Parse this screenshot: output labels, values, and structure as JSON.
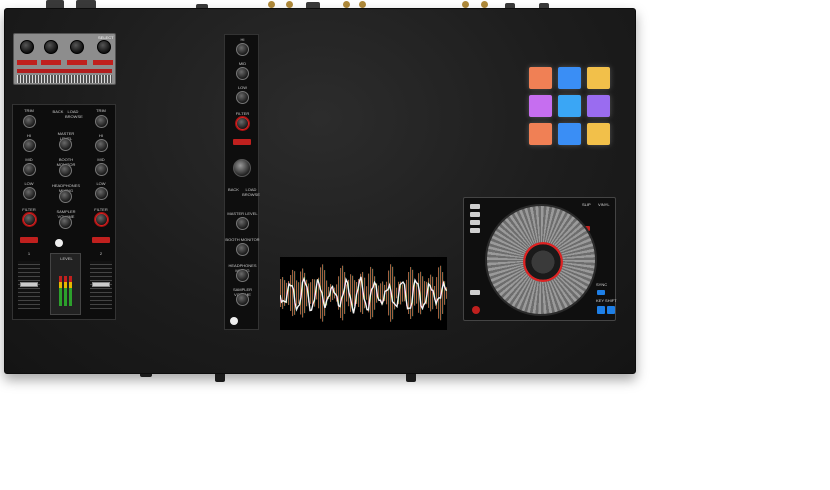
{
  "fx_unit": {
    "select_label": "SELECT"
  },
  "mixer": {
    "left_channel": {
      "trim": "TRIM",
      "hi": "HI",
      "mid": "MID",
      "low": "LOW",
      "filter": "FILTER",
      "cue_label": "1"
    },
    "right_channel": {
      "trim": "TRIM",
      "hi": "HI",
      "mid": "MID",
      "low": "LOW",
      "filter": "FILTER",
      "cue_label": "2"
    },
    "center": {
      "tabs": [
        "BACK",
        "LOAD BROWSE"
      ],
      "master_level": "MASTER LEVEL",
      "booth_monitor": "BOOTH MONITOR",
      "headphones_mixing": "HEADPHONES MIXING",
      "sampler_volume": "SAMPLER VOLUME",
      "level": "LEVEL"
    }
  },
  "vstrip": {
    "hi": "HI",
    "mid": "MID",
    "low": "LOW",
    "filter": "FILTER",
    "master_level": "MASTER LEVEL",
    "booth_monitor": "BOOTH MONITOR",
    "headphones_mixing": "HEADPHONES MIXING",
    "sampler_volume": "SAMPLER VOLUME",
    "back": "BACK",
    "load_browse": "LOAD BROWSE"
  },
  "pads": {
    "colors": [
      "#f08055",
      "#3a8ef5",
      "#f2c04a",
      "#c66ef0",
      "#3aa6f5",
      "#9a6cf0",
      "#f08055",
      "#3a8ef5",
      "#f2c04a"
    ]
  },
  "deck": {
    "slip": "SLIP",
    "vinyl": "VINYL",
    "sync": "SYNC",
    "shift": "SHIFT",
    "key_shift": "KEY SHIFT"
  },
  "colors": {
    "accent_red": "#c0201e",
    "accent_blue": "#1e7fe6",
    "body": "#1d1d1d"
  }
}
